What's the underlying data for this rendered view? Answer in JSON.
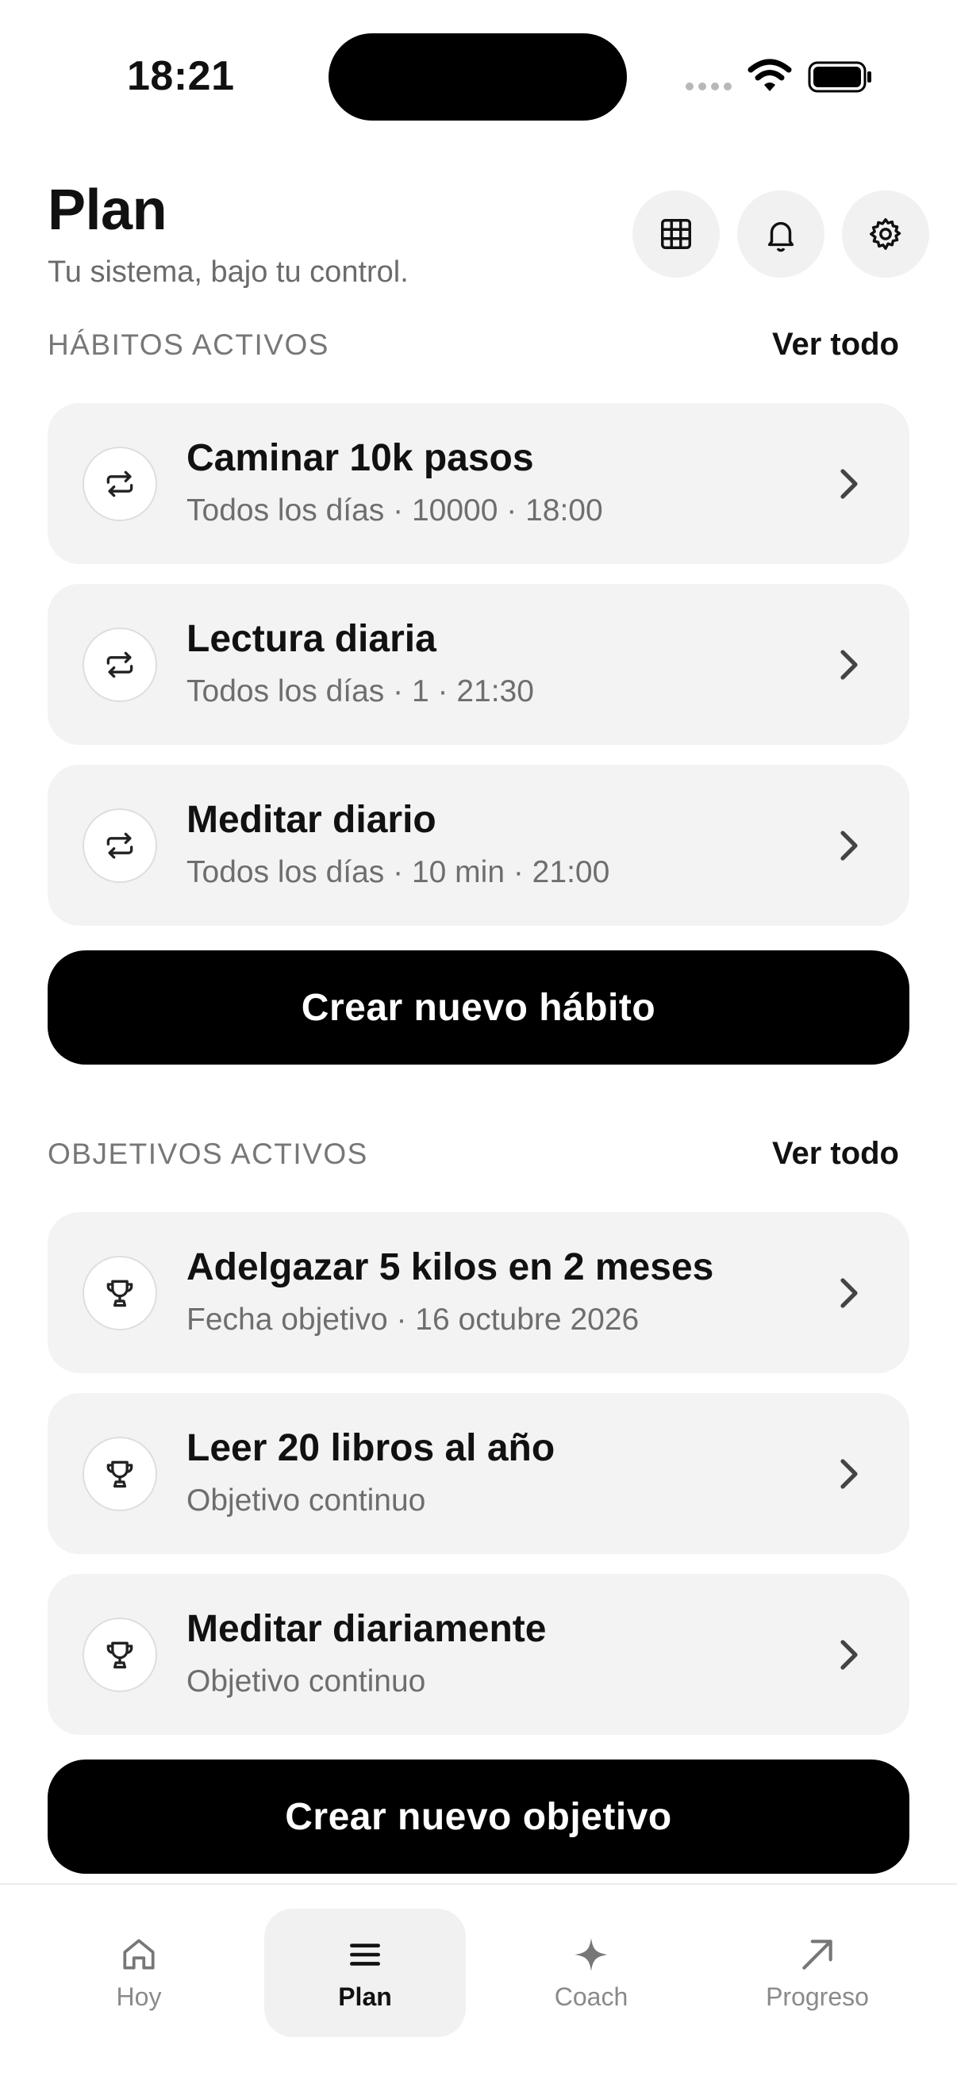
{
  "status_bar": {
    "time": "18:21"
  },
  "header": {
    "title": "Plan",
    "subtitle": "Tu sistema, bajo tu control."
  },
  "habits_section": {
    "label": "HÁBITOS ACTIVOS",
    "see_all": "Ver todo",
    "items": [
      {
        "title": "Caminar 10k pasos",
        "subtitle": "Todos los días · 10000 · 18:00"
      },
      {
        "title": "Lectura diaria",
        "subtitle": "Todos los días · 1 · 21:30"
      },
      {
        "title": "Meditar diario",
        "subtitle": "Todos los días · 10 min · 21:00"
      }
    ],
    "create_button": "Crear nuevo hábito"
  },
  "goals_section": {
    "label": "OBJETIVOS ACTIVOS",
    "see_all": "Ver todo",
    "items": [
      {
        "title": "Adelgazar 5 kilos en 2 meses",
        "subtitle": "Fecha objetivo · 16 octubre 2026"
      },
      {
        "title": "Leer 20 libros al año",
        "subtitle": "Objetivo continuo"
      },
      {
        "title": "Meditar diariamente",
        "subtitle": "Objetivo continuo"
      }
    ],
    "create_button": "Crear nuevo objetivo"
  },
  "bottom_nav": {
    "items": [
      {
        "label": "Hoy",
        "icon": "home-icon",
        "active": false
      },
      {
        "label": "Plan",
        "icon": "menu-icon",
        "active": true
      },
      {
        "label": "Coach",
        "icon": "sparkle-icon",
        "active": false
      },
      {
        "label": "Progreso",
        "icon": "arrow-up-right-icon",
        "active": false
      }
    ]
  },
  "icons": {
    "header_buttons": [
      "grid-icon",
      "bell-icon",
      "gear-icon"
    ],
    "habit_item": "repeat-icon",
    "goal_item": "trophy-icon",
    "row_action": "chevron-right-icon"
  },
  "colors": {
    "background": "#ffffff",
    "card": "#f3f3f3",
    "primary_button": "#000000",
    "muted_text": "#6e6e6e"
  }
}
